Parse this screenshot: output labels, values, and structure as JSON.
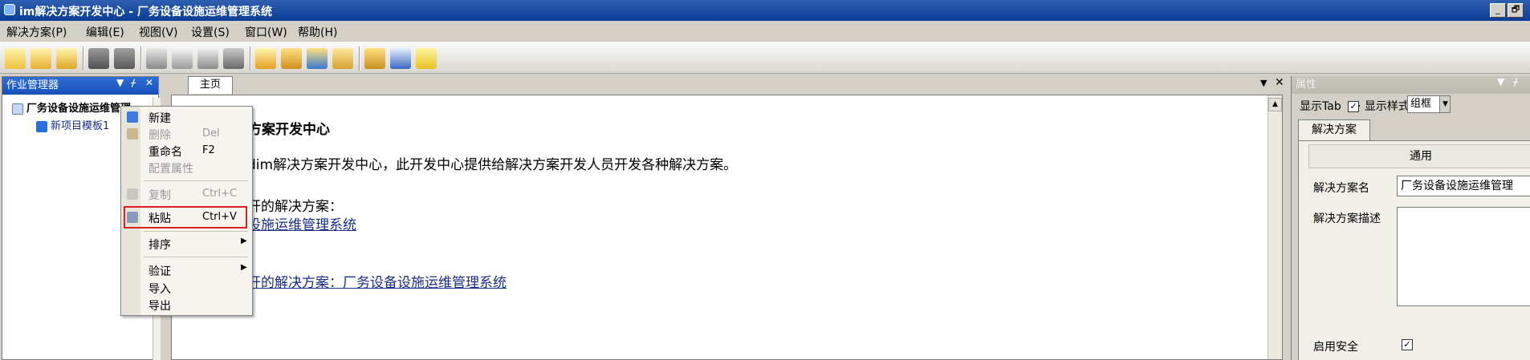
{
  "window": {
    "title": "im解决方案开发中心 - 厂务设备设施运维管理系统",
    "minimize": "_",
    "restore": "🗗"
  },
  "menu": [
    "解决方案(P)",
    "编辑(E)",
    "视图(V)",
    "设置(S)",
    "窗口(W)",
    "帮助(H)"
  ],
  "toolbar_icons": [
    "new-solution-icon",
    "open-folder-icon",
    "edit-folder-icon",
    "save-icon",
    "save-all-icon",
    "cut-icon",
    "copy-icon",
    "paste-icon",
    "delete-icon",
    "edit-icon",
    "bridge-icon",
    "upload-icon",
    "printer-icon",
    "deploy-icon",
    "validate-icon",
    "notes-icon"
  ],
  "left_panel": {
    "title": "作业管理器",
    "root": "厂务设备设施运维管理",
    "child": "新项目模板1"
  },
  "main": {
    "tab": "主页",
    "title": "方案开发中心",
    "intro": "dim解决方案开发中心，此开发中心提供给解决方案开发人员开发各种解决方案。",
    "recent": "开的解决方案：",
    "link1": "设施运维管理系统",
    "link2": "开的解决方案：厂务设备设施运维管理系统"
  },
  "context_menu": [
    {
      "label": "新建",
      "shortcut": "",
      "disabled": false,
      "icon": "new-icon"
    },
    {
      "label": "删除",
      "shortcut": "Del",
      "disabled": true,
      "icon": "delete-icon"
    },
    {
      "label": "重命名",
      "shortcut": "F2",
      "disabled": false,
      "icon": ""
    },
    {
      "label": "配置属性",
      "shortcut": "",
      "disabled": true,
      "icon": ""
    },
    {
      "label": "复制",
      "shortcut": "Ctrl+C",
      "disabled": true,
      "icon": "copy-icon"
    },
    {
      "label": "粘贴",
      "shortcut": "Ctrl+V",
      "disabled": false,
      "icon": "paste-icon"
    },
    {
      "label": "排序",
      "shortcut": "",
      "disabled": false,
      "submenu": true
    },
    {
      "label": "验证",
      "shortcut": "",
      "disabled": false,
      "submenu": true
    },
    {
      "label": "导入",
      "shortcut": "",
      "disabled": false
    },
    {
      "label": "导出",
      "shortcut": "",
      "disabled": false
    }
  ],
  "properties": {
    "title": "属性",
    "show_tab_label": "显示Tab",
    "show_tab_checked": "✓",
    "show_style_label": "· 显示样式",
    "show_style_value": "组框",
    "tab": "解决方案",
    "group": "通用",
    "name_label": "解决方案名",
    "name_value": "厂务设备设施运维管理",
    "desc_label": "解决方案描述",
    "desc_value": "",
    "security_label": "启用安全",
    "security_checked": "✓"
  },
  "colors": {
    "titlebar": "#0a3d96",
    "panel_header": "#1750b8",
    "highlight_box": "#e02020",
    "link": "#1a2d8c"
  }
}
